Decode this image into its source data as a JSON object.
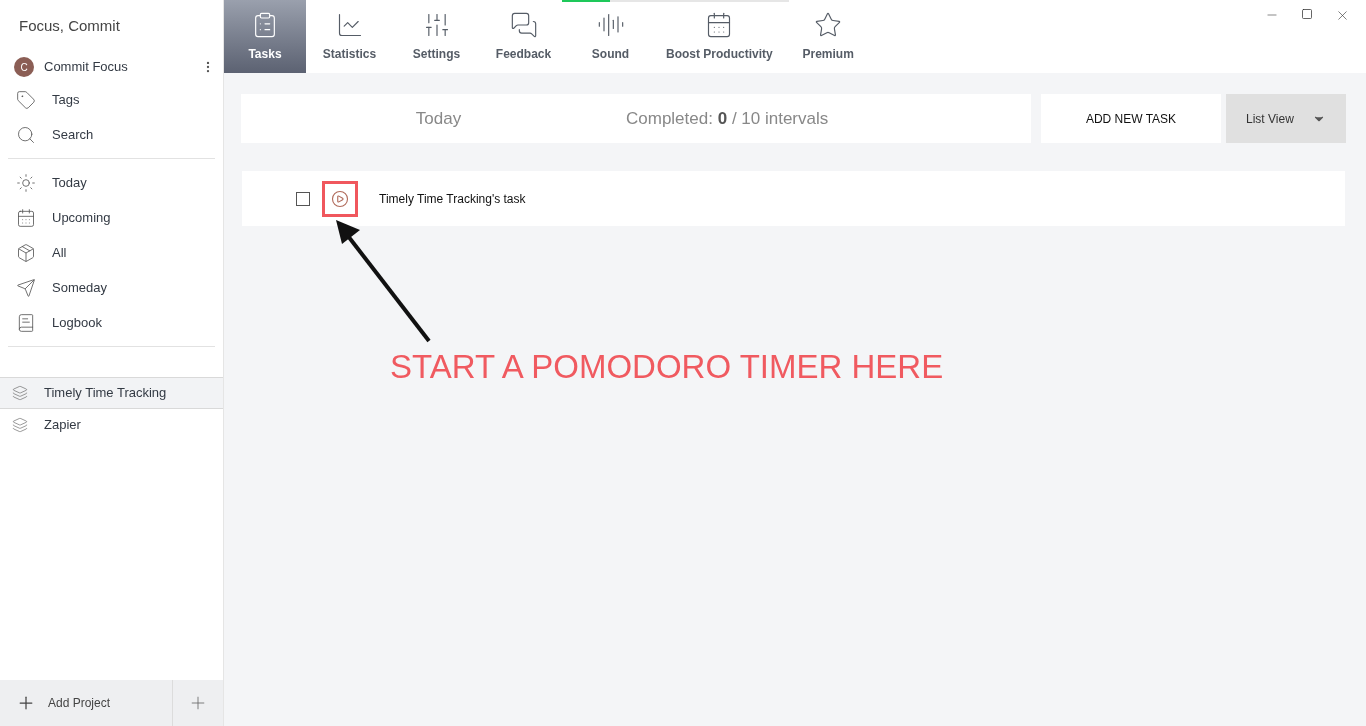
{
  "app_title": "Focus, Commit",
  "account": {
    "initial": "C",
    "name": "Commit Focus"
  },
  "sidebar": {
    "tools": [
      {
        "kind": "tags",
        "label": "Tags"
      },
      {
        "kind": "search",
        "label": "Search"
      }
    ],
    "views": [
      {
        "kind": "today",
        "label": "Today"
      },
      {
        "kind": "upcoming",
        "label": "Upcoming"
      },
      {
        "kind": "all",
        "label": "All"
      },
      {
        "kind": "someday",
        "label": "Someday"
      },
      {
        "kind": "logbook",
        "label": "Logbook"
      }
    ],
    "projects": [
      {
        "label": "Timely Time Tracking",
        "selected": true
      },
      {
        "label": "Zapier",
        "selected": false
      }
    ],
    "add_project": "Add Project"
  },
  "toolbar": [
    {
      "kind": "tasks",
      "label": "Tasks",
      "selected": true
    },
    {
      "kind": "statistics",
      "label": "Statistics",
      "selected": false
    },
    {
      "kind": "settings",
      "label": "Settings",
      "selected": false
    },
    {
      "kind": "feedback",
      "label": "Feedback",
      "selected": false
    },
    {
      "kind": "sound",
      "label": "Sound",
      "selected": false
    },
    {
      "kind": "boost",
      "label": "Boost Productivity",
      "selected": false
    },
    {
      "kind": "premium",
      "label": "Premium",
      "selected": false
    }
  ],
  "loading": {
    "level": 0.21
  },
  "header": {
    "day": "Today",
    "completed_label": "Completed:",
    "completed": "0",
    "total": "/ 10 intervals",
    "add_button": "ADD NEW TASK",
    "view_select": "List View"
  },
  "tasks": [
    {
      "title": "Timely Time Tracking's task",
      "checked": false,
      "highlighted": true
    }
  ],
  "annotation": "START A POMODORO TIMER HERE"
}
